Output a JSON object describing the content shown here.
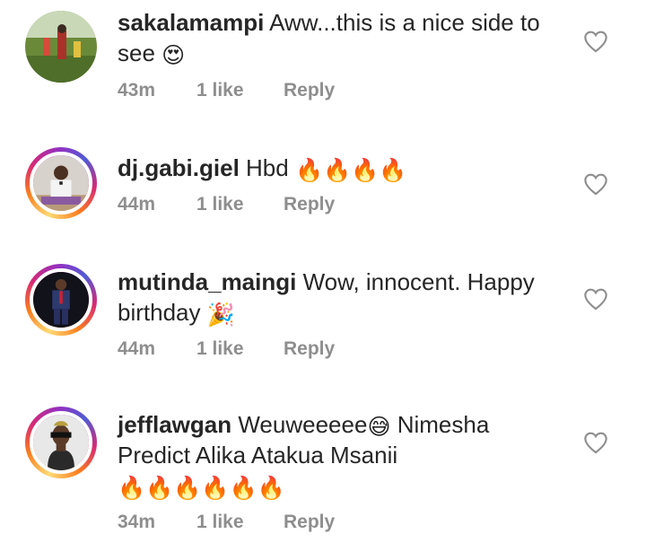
{
  "comments": [
    {
      "username": "sakalamampi",
      "text": " Aww...this is a nice side to see ",
      "emojis": "😍",
      "time": "43m",
      "likes": "1 like",
      "reply": "Reply"
    },
    {
      "username": "dj.gabi.giel",
      "text": " Hbd ",
      "emojis": "🔥🔥🔥🔥",
      "time": "44m",
      "likes": "1 like",
      "reply": "Reply"
    },
    {
      "username": "mutinda_maingi",
      "text": " Wow, innocent. Happy birthday ",
      "emojis": "🎉",
      "time": "44m",
      "likes": "1 like",
      "reply": "Reply"
    },
    {
      "username": "jefflawgan",
      "text_a": " Weuweeeee",
      "emoji_a": "😅",
      "text_b": " Nimesha Predict Alika Atakua Msanii ",
      "emojis": "🔥🔥🔥🔥🔥🔥",
      "time": "34m",
      "likes": "1 like",
      "reply": "Reply"
    }
  ],
  "icons": {
    "like": "heart-outline-icon"
  },
  "colors": {
    "text": "#262626",
    "meta": "#8e8e8e",
    "heart": "#8e8e8e"
  }
}
